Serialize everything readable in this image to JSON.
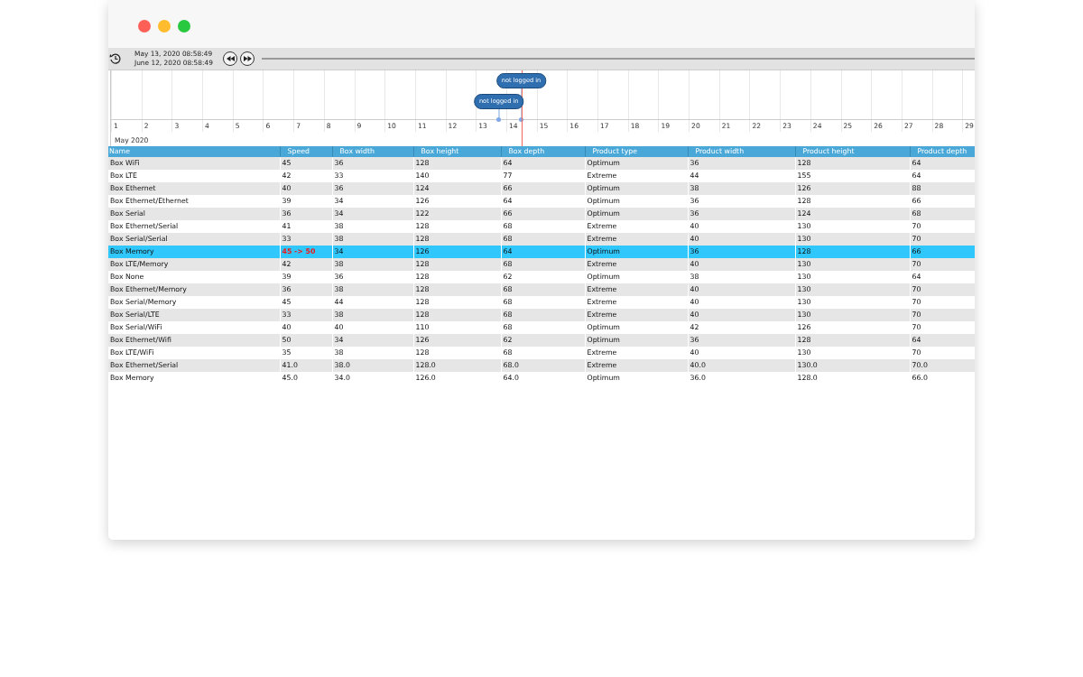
{
  "toolbar": {
    "start_time": "May 13, 2020 08:58:49",
    "end_time": "June 12, 2020 08:58:49"
  },
  "timeline": {
    "days": [
      "1",
      "2",
      "3",
      "4",
      "5",
      "6",
      "7",
      "8",
      "9",
      "10",
      "11",
      "12",
      "13",
      "14",
      "15",
      "16",
      "17",
      "18",
      "19",
      "20",
      "21",
      "22",
      "23",
      "24",
      "25",
      "26",
      "27",
      "28",
      "29"
    ],
    "month": "May 2020",
    "cursor": {
      "level": 0.475
    },
    "events": [
      {
        "label": "not logged in",
        "level": 0.475
      },
      {
        "label": "not logged in",
        "level": 0.449
      }
    ]
  },
  "table": {
    "columns": [
      "Name",
      "Speed",
      "Box width",
      "Box height",
      "Box depth",
      "Product type",
      "Product width",
      "Product height",
      "Product depth"
    ],
    "rows": [
      {
        "selected": false,
        "cells": [
          {
            "text": "Box WiFi",
            "changed": false
          },
          {
            "text": "45",
            "changed": false
          },
          {
            "text": "36",
            "changed": false
          },
          {
            "text": "128",
            "changed": false
          },
          {
            "text": "64",
            "changed": false
          },
          {
            "text": "Optimum",
            "changed": false
          },
          {
            "text": "36",
            "changed": false
          },
          {
            "text": "128",
            "changed": false
          },
          {
            "text": "64",
            "changed": false
          }
        ]
      },
      {
        "selected": false,
        "cells": [
          {
            "text": "Box LTE",
            "changed": false
          },
          {
            "text": "42",
            "changed": false
          },
          {
            "text": "33",
            "changed": false
          },
          {
            "text": "140",
            "changed": false
          },
          {
            "text": "77",
            "changed": false
          },
          {
            "text": "Extreme",
            "changed": false
          },
          {
            "text": "44",
            "changed": false
          },
          {
            "text": "155",
            "changed": false
          },
          {
            "text": "64",
            "changed": false
          }
        ]
      },
      {
        "selected": false,
        "cells": [
          {
            "text": "Box Ethernet",
            "changed": false
          },
          {
            "text": "40",
            "changed": false
          },
          {
            "text": "36",
            "changed": false
          },
          {
            "text": "124",
            "changed": false
          },
          {
            "text": "66",
            "changed": false
          },
          {
            "text": "Optimum",
            "changed": false
          },
          {
            "text": "38",
            "changed": false
          },
          {
            "text": "126",
            "changed": false
          },
          {
            "text": "88",
            "changed": false
          }
        ]
      },
      {
        "selected": false,
        "cells": [
          {
            "text": "Box Ethernet/Ethernet",
            "changed": false
          },
          {
            "text": "39",
            "changed": false
          },
          {
            "text": "34",
            "changed": false
          },
          {
            "text": "126",
            "changed": false
          },
          {
            "text": "64",
            "changed": false
          },
          {
            "text": "Optimum",
            "changed": false
          },
          {
            "text": "36",
            "changed": false
          },
          {
            "text": "128",
            "changed": false
          },
          {
            "text": "66",
            "changed": false
          }
        ]
      },
      {
        "selected": false,
        "cells": [
          {
            "text": "Box Serial",
            "changed": false
          },
          {
            "text": "36",
            "changed": false
          },
          {
            "text": "34",
            "changed": false
          },
          {
            "text": "122",
            "changed": false
          },
          {
            "text": "66",
            "changed": false
          },
          {
            "text": "Optimum",
            "changed": false
          },
          {
            "text": "36",
            "changed": false
          },
          {
            "text": "124",
            "changed": false
          },
          {
            "text": "68",
            "changed": false
          }
        ]
      },
      {
        "selected": false,
        "cells": [
          {
            "text": "Box Ethernet/Serial",
            "changed": false
          },
          {
            "text": "41",
            "changed": false
          },
          {
            "text": "38",
            "changed": false
          },
          {
            "text": "128",
            "changed": false
          },
          {
            "text": "68",
            "changed": false
          },
          {
            "text": "Extreme",
            "changed": false
          },
          {
            "text": "40",
            "changed": false
          },
          {
            "text": "130",
            "changed": false
          },
          {
            "text": "70",
            "changed": false
          }
        ]
      },
      {
        "selected": false,
        "cells": [
          {
            "text": "Box Serial/Serial",
            "changed": false
          },
          {
            "text": "33",
            "changed": false
          },
          {
            "text": "38",
            "changed": false
          },
          {
            "text": "128",
            "changed": false
          },
          {
            "text": "68",
            "changed": false
          },
          {
            "text": "Extreme",
            "changed": false
          },
          {
            "text": "40",
            "changed": false
          },
          {
            "text": "130",
            "changed": false
          },
          {
            "text": "70",
            "changed": false
          }
        ]
      },
      {
        "selected": true,
        "cells": [
          {
            "text": "Box Memory",
            "changed": false
          },
          {
            "text": "45 -> 50",
            "changed": true
          },
          {
            "text": "34",
            "changed": false
          },
          {
            "text": "126",
            "changed": false
          },
          {
            "text": "64",
            "changed": false
          },
          {
            "text": "Optimum",
            "changed": false
          },
          {
            "text": "36",
            "changed": false
          },
          {
            "text": "128",
            "changed": false
          },
          {
            "text": "66",
            "changed": false
          }
        ]
      },
      {
        "selected": false,
        "cells": [
          {
            "text": "Box LTE/Memory",
            "changed": false
          },
          {
            "text": "42",
            "changed": false
          },
          {
            "text": "38",
            "changed": false
          },
          {
            "text": "128",
            "changed": false
          },
          {
            "text": "68",
            "changed": false
          },
          {
            "text": "Extreme",
            "changed": false
          },
          {
            "text": "40",
            "changed": false
          },
          {
            "text": "130",
            "changed": false
          },
          {
            "text": "70",
            "changed": false
          }
        ]
      },
      {
        "selected": false,
        "cells": [
          {
            "text": "Box None",
            "changed": false
          },
          {
            "text": "39",
            "changed": false
          },
          {
            "text": "36",
            "changed": false
          },
          {
            "text": "128",
            "changed": false
          },
          {
            "text": "62",
            "changed": false
          },
          {
            "text": "Optimum",
            "changed": false
          },
          {
            "text": "38",
            "changed": false
          },
          {
            "text": "130",
            "changed": false
          },
          {
            "text": "64",
            "changed": false
          }
        ]
      },
      {
        "selected": false,
        "cells": [
          {
            "text": "Box Ethernet/Memory",
            "changed": false
          },
          {
            "text": "36",
            "changed": false
          },
          {
            "text": "38",
            "changed": false
          },
          {
            "text": "128",
            "changed": false
          },
          {
            "text": "68",
            "changed": false
          },
          {
            "text": "Extreme",
            "changed": false
          },
          {
            "text": "40",
            "changed": false
          },
          {
            "text": "130",
            "changed": false
          },
          {
            "text": "70",
            "changed": false
          }
        ]
      },
      {
        "selected": false,
        "cells": [
          {
            "text": "Box Serial/Memory",
            "changed": false
          },
          {
            "text": "45",
            "changed": false
          },
          {
            "text": "44",
            "changed": false
          },
          {
            "text": "128",
            "changed": false
          },
          {
            "text": "68",
            "changed": false
          },
          {
            "text": "Extreme",
            "changed": false
          },
          {
            "text": "40",
            "changed": false
          },
          {
            "text": "130",
            "changed": false
          },
          {
            "text": "70",
            "changed": false
          }
        ]
      },
      {
        "selected": false,
        "cells": [
          {
            "text": "Box Serial/LTE",
            "changed": false
          },
          {
            "text": "33",
            "changed": false
          },
          {
            "text": "38",
            "changed": false
          },
          {
            "text": "128",
            "changed": false
          },
          {
            "text": "68",
            "changed": false
          },
          {
            "text": "Extreme",
            "changed": false
          },
          {
            "text": "40",
            "changed": false
          },
          {
            "text": "130",
            "changed": false
          },
          {
            "text": "70",
            "changed": false
          }
        ]
      },
      {
        "selected": false,
        "cells": [
          {
            "text": "Box Serial/WiFi",
            "changed": false
          },
          {
            "text": "40",
            "changed": false
          },
          {
            "text": "40",
            "changed": false
          },
          {
            "text": "110",
            "changed": false
          },
          {
            "text": "68",
            "changed": false
          },
          {
            "text": "Optimum",
            "changed": false
          },
          {
            "text": "42",
            "changed": false
          },
          {
            "text": "126",
            "changed": false
          },
          {
            "text": "70",
            "changed": false
          }
        ]
      },
      {
        "selected": false,
        "cells": [
          {
            "text": "Box Ethernet/Wifi",
            "changed": false
          },
          {
            "text": "50",
            "changed": false
          },
          {
            "text": "34",
            "changed": false
          },
          {
            "text": "126",
            "changed": false
          },
          {
            "text": "62",
            "changed": false
          },
          {
            "text": "Optimum",
            "changed": false
          },
          {
            "text": "36",
            "changed": false
          },
          {
            "text": "128",
            "changed": false
          },
          {
            "text": "64",
            "changed": false
          }
        ]
      },
      {
        "selected": false,
        "cells": [
          {
            "text": "Box LTE/WiFi",
            "changed": false
          },
          {
            "text": "35",
            "changed": false
          },
          {
            "text": "38",
            "changed": false
          },
          {
            "text": "128",
            "changed": false
          },
          {
            "text": "68",
            "changed": false
          },
          {
            "text": "Extreme",
            "changed": false
          },
          {
            "text": "40",
            "changed": false
          },
          {
            "text": "130",
            "changed": false
          },
          {
            "text": "70",
            "changed": false
          }
        ]
      },
      {
        "selected": false,
        "cells": [
          {
            "text": "Box Ethernet/Serial",
            "changed": false
          },
          {
            "text": "41.0",
            "changed": false
          },
          {
            "text": "38.0",
            "changed": false
          },
          {
            "text": "128.0",
            "changed": false
          },
          {
            "text": "68.0",
            "changed": false
          },
          {
            "text": "Extreme",
            "changed": false
          },
          {
            "text": "40.0",
            "changed": false
          },
          {
            "text": "130.0",
            "changed": false
          },
          {
            "text": "70.0",
            "changed": false
          }
        ]
      },
      {
        "selected": false,
        "cells": [
          {
            "text": "Box Memory",
            "changed": false
          },
          {
            "text": "45.0",
            "changed": false
          },
          {
            "text": "34.0",
            "changed": false
          },
          {
            "text": "126.0",
            "changed": false
          },
          {
            "text": "64.0",
            "changed": false
          },
          {
            "text": "Optimum",
            "changed": false
          },
          {
            "text": "36.0",
            "changed": false
          },
          {
            "text": "128.0",
            "changed": false
          },
          {
            "text": "66.0",
            "changed": false
          }
        ]
      }
    ]
  }
}
